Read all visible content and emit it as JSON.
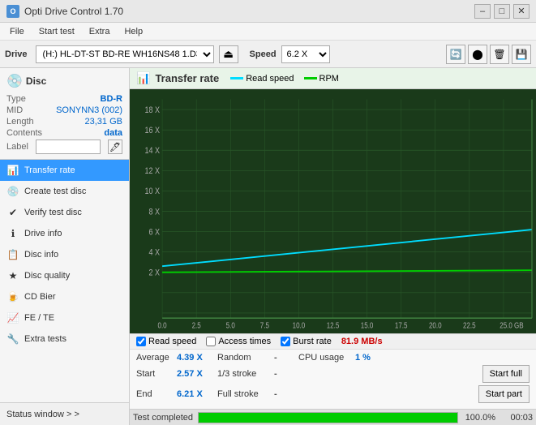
{
  "titlebar": {
    "icon": "O",
    "title": "Opti Drive Control 1.70",
    "minimize": "–",
    "maximize": "□",
    "close": "✕"
  },
  "menubar": {
    "items": [
      "File",
      "Start test",
      "Extra",
      "Help"
    ]
  },
  "drivebar": {
    "drive_label": "Drive",
    "drive_value": "(H:)  HL-DT-ST BD-RE  WH16NS48 1.D3",
    "speed_label": "Speed",
    "speed_value": "6.2 X"
  },
  "disc": {
    "header": "Disc",
    "type_label": "Type",
    "type_value": "BD-R",
    "mid_label": "MID",
    "mid_value": "SONYNN3 (002)",
    "length_label": "Length",
    "length_value": "23,31 GB",
    "contents_label": "Contents",
    "contents_value": "data",
    "label_label": "Label",
    "label_value": ""
  },
  "nav": {
    "items": [
      {
        "id": "transfer-rate",
        "label": "Transfer rate",
        "icon": "📊",
        "active": true
      },
      {
        "id": "create-test-disc",
        "label": "Create test disc",
        "icon": "💿",
        "active": false
      },
      {
        "id": "verify-test-disc",
        "label": "Verify test disc",
        "icon": "✔",
        "active": false
      },
      {
        "id": "drive-info",
        "label": "Drive info",
        "icon": "ℹ",
        "active": false
      },
      {
        "id": "disc-info",
        "label": "Disc info",
        "icon": "📋",
        "active": false
      },
      {
        "id": "disc-quality",
        "label": "Disc quality",
        "icon": "★",
        "active": false
      },
      {
        "id": "cd-bier",
        "label": "CD Bier",
        "icon": "🍺",
        "active": false
      },
      {
        "id": "fe-te",
        "label": "FE / TE",
        "icon": "📈",
        "active": false
      },
      {
        "id": "extra-tests",
        "label": "Extra tests",
        "icon": "🔧",
        "active": false
      }
    ],
    "status_window": "Status window > >"
  },
  "chart": {
    "title": "Transfer rate",
    "legend": [
      {
        "label": "Read speed",
        "color": "#00ddff"
      },
      {
        "label": "RPM",
        "color": "#00cc00"
      }
    ],
    "y_axis": [
      "18 X",
      "16 X",
      "14 X",
      "12 X",
      "10 X",
      "8 X",
      "6 X",
      "4 X",
      "2 X"
    ],
    "x_axis": [
      "0.0",
      "2.5",
      "5.0",
      "7.5",
      "10.0",
      "12.5",
      "15.0",
      "17.5",
      "20.0",
      "22.5",
      "25.0 GB"
    ],
    "read_line_color": "#00ddff",
    "rpm_line_color": "#00cc00",
    "burst_color": "#ff4444"
  },
  "chart_footer": {
    "read_speed_label": "Read speed",
    "access_times_label": "Access times",
    "burst_rate_label": "Burst rate",
    "burst_rate_value": "81.9 MB/s",
    "read_checked": true,
    "access_checked": false,
    "burst_checked": true
  },
  "stats": {
    "rows": [
      {
        "col1_label": "Average",
        "col1_val": "4.39 X",
        "col2_label": "Random",
        "col2_val": "-",
        "col3_label": "CPU usage",
        "col3_val": "1 %"
      },
      {
        "col1_label": "Start",
        "col1_val": "2.57 X",
        "col2_label": "1/3 stroke",
        "col2_val": "-",
        "col3_label": "",
        "col3_val": "",
        "btn": "Start full"
      },
      {
        "col1_label": "End",
        "col1_val": "6.21 X",
        "col2_label": "Full stroke",
        "col2_val": "-",
        "col3_label": "",
        "col3_val": "",
        "btn": "Start part"
      }
    ]
  },
  "progress": {
    "status_text": "Test completed",
    "percent": 100,
    "percent_label": "100.0%",
    "time_label": "00:03"
  }
}
